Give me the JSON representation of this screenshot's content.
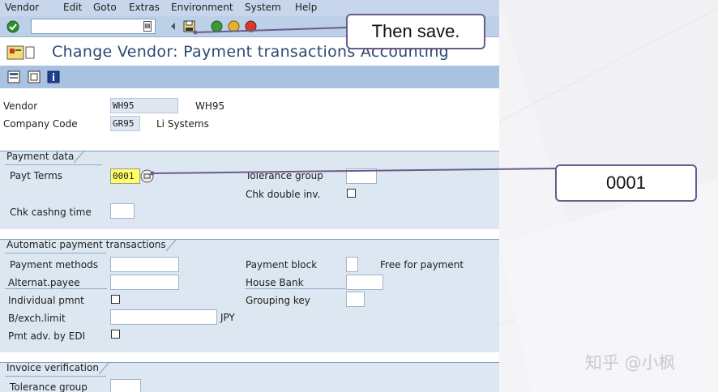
{
  "menubar": {
    "items": [
      "Vendor",
      "Edit",
      "Goto",
      "Extras",
      "Environment",
      "System",
      "Help"
    ]
  },
  "toolbar": {
    "command_value": "",
    "icons": [
      "enter-icon",
      "back-icon",
      "save-icon",
      "green-arrow-icon",
      "exit-icon",
      "cancel-icon"
    ]
  },
  "title": {
    "text": "Change Vendor: Payment transactions Accounting"
  },
  "app_toolbar": {
    "icons": [
      "overview-icon",
      "document-icon",
      "info-icon"
    ]
  },
  "header": {
    "vendor_label": "Vendor",
    "vendor_value": "WH95",
    "vendor_name": "WH95",
    "company_code_label": "Company Code",
    "company_code_value": "GR95",
    "company_name": "Li Systems"
  },
  "payment_data": {
    "group_title": "Payment data",
    "payt_terms_label": "Payt Terms",
    "payt_terms_value": "0001",
    "tolerance_group_label": "Tolerance group",
    "tolerance_group_value": "",
    "chk_double_inv_label": "Chk double inv.",
    "chk_double_inv_checked": false,
    "chk_cashng_time_label": "Chk cashng time",
    "chk_cashng_time_value": ""
  },
  "auto_payment": {
    "group_title": "Automatic payment transactions",
    "payment_methods_label": "Payment methods",
    "payment_methods_value": "",
    "alternat_payee_label": "Alternat.payee",
    "alternat_payee_value": "",
    "individual_pmnt_label": "Individual pmnt",
    "individual_pmnt_checked": false,
    "bexch_limit_label": "B/exch.limit",
    "bexch_limit_value": "",
    "bexch_currency": "JPY",
    "pmt_adv_edi_label": "Pmt adv. by EDI",
    "pmt_adv_edi_checked": false,
    "payment_block_label": "Payment block",
    "payment_block_value": "",
    "payment_block_text": "Free for payment",
    "house_bank_label": "House Bank",
    "house_bank_value": "",
    "grouping_key_label": "Grouping key",
    "grouping_key_value": ""
  },
  "invoice_verification": {
    "group_title": "Invoice verification",
    "tolerance_group_label": "Tolerance group",
    "tolerance_group_value": ""
  },
  "annotations": {
    "save_callout": "Then save.",
    "terms_callout": "0001"
  },
  "watermark": "知乎 @小枫",
  "colors": {
    "menubar": "#c7d6ea",
    "toolbar": "#bcd0e8",
    "app_toolbar": "#a9c2e2",
    "group_background": "#dde7f2",
    "title_text": "#2c4a72",
    "highlight_field": "#ffff66",
    "callout_border": "#6b5b8e",
    "callout_line": "#6b5b8e"
  }
}
